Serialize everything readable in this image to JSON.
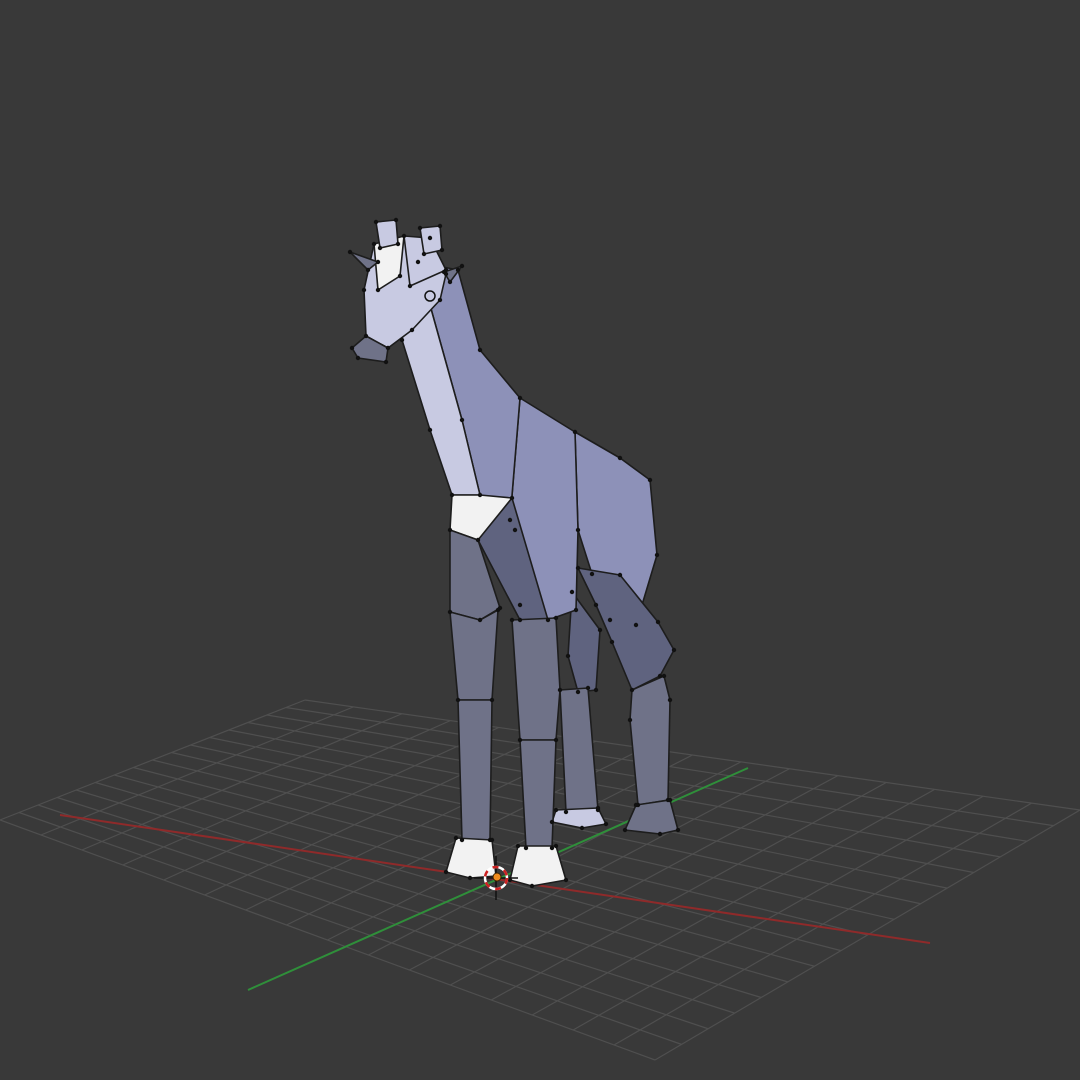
{
  "viewport": {
    "view": "3D Viewport",
    "background_color": "#393939",
    "grid": {
      "visible": true,
      "line_color": "#4f4f4f",
      "x_axis_color": "#8f2a2a",
      "y_axis_color": "#2f8f3a"
    },
    "object": {
      "name_icon": "giraffe-mesh",
      "mode": "edit-mode-vertices-visible",
      "colors": {
        "base": "#8d91b8",
        "light": "#c8cae2",
        "dark": "#5f637f",
        "shadow": "#6f7288",
        "highlight": "#f2f2f2",
        "edge": "#1d1d1d"
      }
    },
    "cursor_3d": {
      "visible": true,
      "ring_colors": [
        "#ffffff",
        "#cc2222"
      ],
      "origin_color": "#f08a1c"
    }
  }
}
